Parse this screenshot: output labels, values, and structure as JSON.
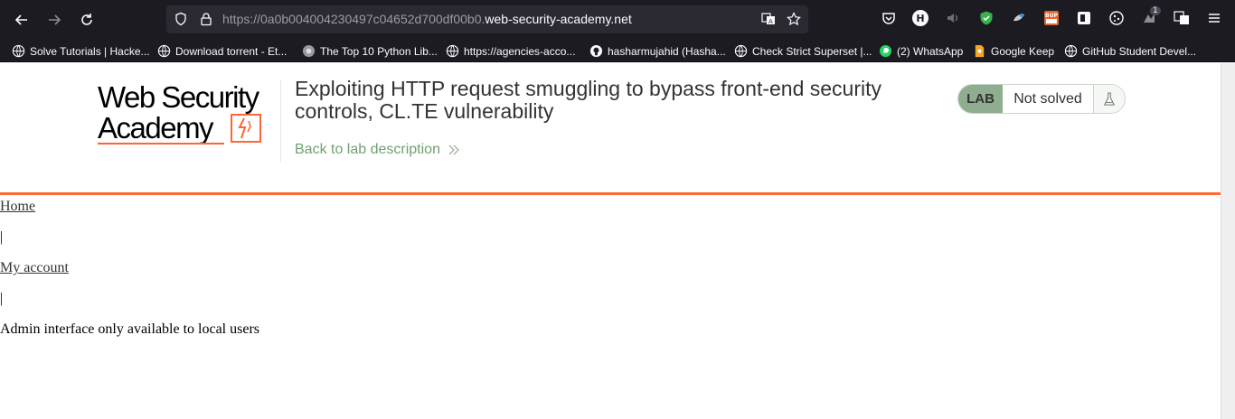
{
  "browser": {
    "url_prefix": "https://0a0b004004230497c04652d700df00b0.",
    "url_domain": "web-security-academy.net",
    "icons": [
      "back-icon",
      "forward-icon",
      "reload-icon",
      "shield-icon",
      "lock-icon",
      "translate-icon",
      "star-icon",
      "pocket-icon",
      "extension-h-icon",
      "speaker-icon",
      "adblock-icon",
      "extension-icon",
      "burp-icon",
      "extension-icon",
      "cookie-icon",
      "notification-icon",
      "translate-icon",
      "menu-icon"
    ],
    "ext_h_label": "H",
    "ext_badge": "1"
  },
  "bookmarks": [
    {
      "label": "Solve Tutorials | Hacke...",
      "icon": "globe-icon"
    },
    {
      "label": "Download torrent - Et...",
      "icon": "globe-icon"
    },
    {
      "label": "The Top 10 Python Lib...",
      "icon": "site-icon"
    },
    {
      "label": "https://agencies-acco...",
      "icon": "globe-icon"
    },
    {
      "label": "hasharmujahid (Hasha...",
      "icon": "github-icon"
    },
    {
      "label": "Check Strict Superset |...",
      "icon": "globe-icon"
    },
    {
      "label": "(2) WhatsApp",
      "icon": "whatsapp-icon"
    },
    {
      "label": "Google Keep",
      "icon": "keep-icon"
    },
    {
      "label": "GitHub Student Devel...",
      "icon": "globe-icon"
    }
  ],
  "header": {
    "logo_line1": "Web Security",
    "logo_line2": "Academy",
    "title": "Exploiting HTTP request smuggling to bypass front-end security controls, CL.TE vulnerability",
    "back_link": "Back to lab description",
    "lab_badge": "LAB",
    "status": "Not solved"
  },
  "nav": {
    "home": "Home",
    "sep1": "|",
    "account": "My account",
    "sep2": "|"
  },
  "message": "Admin interface only available to local users",
  "colors": {
    "accent": "#ff6633",
    "lab_green": "#8fad8f",
    "link_green": "#70a070",
    "chrome_bg": "#1c1b22"
  }
}
